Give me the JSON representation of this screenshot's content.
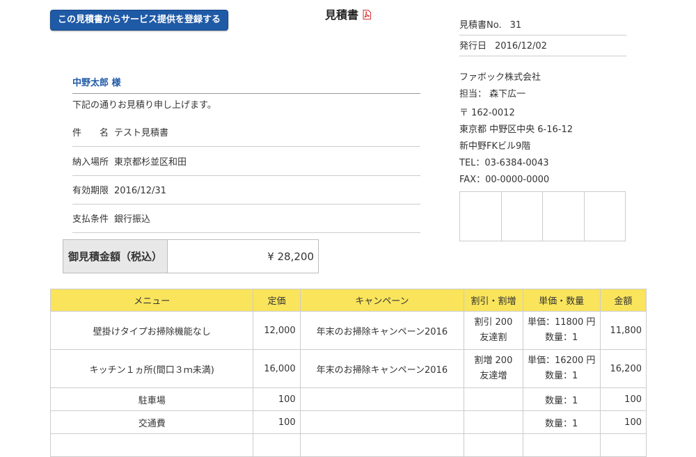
{
  "header": {
    "register_button": "この見積書からサービス提供を登録する",
    "title": "見積書",
    "pdf_icon": "pdf-icon"
  },
  "meta": {
    "number_label": "見積書No.",
    "number_value": "31",
    "date_label": "発行日",
    "date_value": "2016/12/02"
  },
  "company": {
    "name": "ファボック株式会社",
    "contact": "担当：  森下広一",
    "zip": "〒 162-0012",
    "address1": "東京都 中野区中央 6-16-12",
    "address2": "新中野FKビル9階",
    "tel": "TEL：03-6384-0043",
    "fax": "FAX：00-0000-0000"
  },
  "customer": {
    "name": "中野太郎 様",
    "intro": "下記の通りお見積り申し上げます。"
  },
  "info": [
    {
      "label": "件　　名",
      "value": "テスト見積書"
    },
    {
      "label": "納入場所",
      "value": "東京都杉並区和田"
    },
    {
      "label": "有効期限",
      "value": "2016/12/31"
    },
    {
      "label": "支払条件",
      "value": "銀行振込"
    }
  ],
  "total": {
    "label": "御見積金額（税込）",
    "value": "¥  28,200"
  },
  "table": {
    "headers": [
      "メニュー",
      "定価",
      "キャンペーン",
      "割引・割増",
      "単価・数量",
      "金額"
    ],
    "rows": [
      {
        "menu": "壁掛けタイプお掃除機能なし",
        "price": "12,000",
        "campaign": "年末のお掃除キャンペーン2016",
        "discount1": "割引 200",
        "discount2": "友達割",
        "unit1": "単価：11800 円",
        "unit2": "数量：1",
        "amount": "11,800"
      },
      {
        "menu": "キッチン１ヵ所(間口３ｍ未満)",
        "price": "16,000",
        "campaign": "年末のお掃除キャンペーン2016",
        "discount1": "割増 200",
        "discount2": "友達増",
        "unit1": "単価：16200 円",
        "unit2": "数量：1",
        "amount": "16,200"
      },
      {
        "menu": "駐車場",
        "price": "100",
        "campaign": "",
        "discount1": "",
        "discount2": "",
        "unit1": "",
        "unit2": "数量：1",
        "amount": "100"
      },
      {
        "menu": "交通費",
        "price": "100",
        "campaign": "",
        "discount1": "",
        "discount2": "",
        "unit1": "",
        "unit2": "数量：1",
        "amount": "100"
      }
    ]
  }
}
